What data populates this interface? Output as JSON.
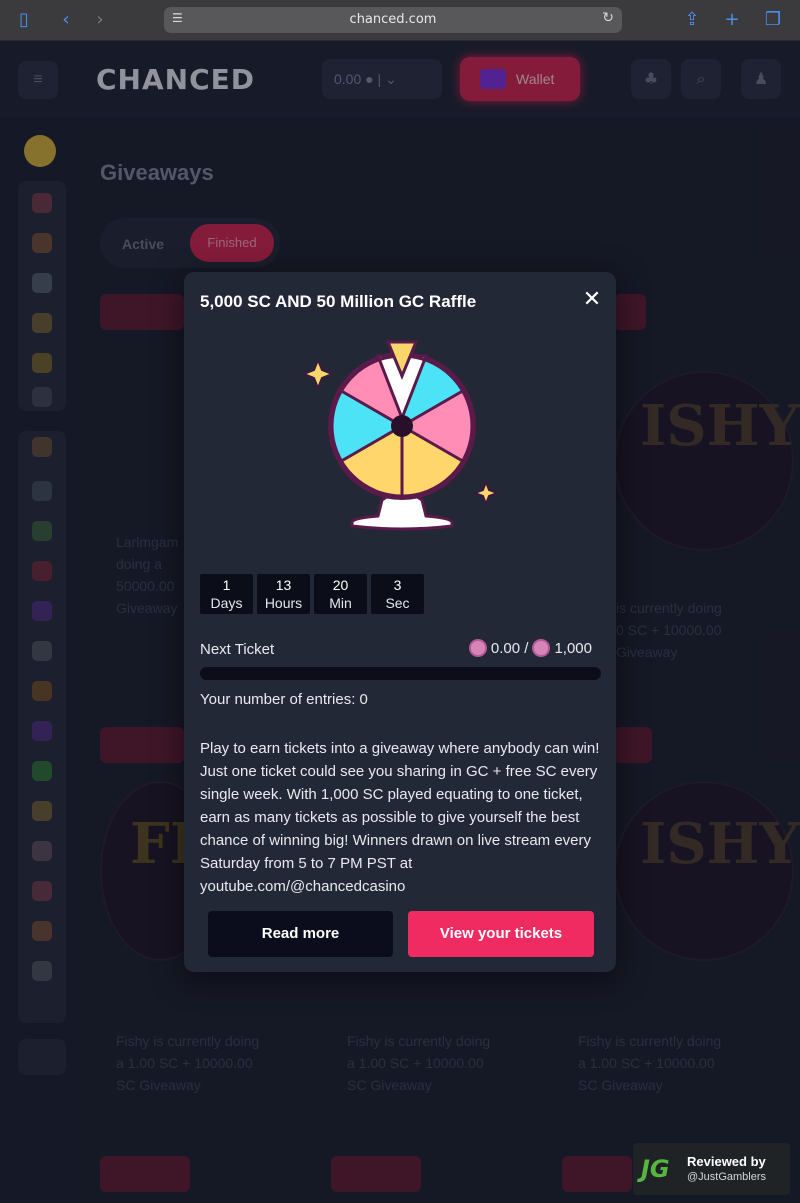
{
  "browser": {
    "url": "chanced.com",
    "icons": {
      "sidebar": "sidebar-icon",
      "back": "back-icon",
      "forward": "forward-icon",
      "share": "share-icon",
      "new_tab": "plus-icon",
      "tabs": "tabs-icon"
    }
  },
  "modal": {
    "title": "5,000 SC AND 50 Million GC Raffle",
    "countdown": [
      {
        "value": "1",
        "unit": "Days"
      },
      {
        "value": "13",
        "unit": "Hours"
      },
      {
        "value": "20",
        "unit": "Min"
      },
      {
        "value": "3",
        "unit": "Sec"
      }
    ],
    "next_ticket": {
      "label": "Next Ticket",
      "current": "0.00 /",
      "target": "1,000",
      "progress_fraction": 0
    },
    "entries_text": "Your number of entries: 0",
    "description": "Play to earn tickets into a giveaway where anybody can win! Just one ticket could see you sharing in GC + free SC every single week. With 1,000 SC played equating to one ticket, earn as many tickets as possible to give yourself the best chance of winning big! Winners drawn on live stream every Saturday from 5 to 7 PM PST at youtube.com/@chancedcasino",
    "read_more_label": "Read more",
    "view_tickets_label": "View your tickets"
  },
  "colors": {
    "accent": "#ef2b62",
    "modal_bg": "#232836",
    "page_bg": "#1a1d2c"
  },
  "badge": {
    "logo": "JG",
    "line1": "Reviewed by",
    "line2": "@JustGamblers"
  }
}
